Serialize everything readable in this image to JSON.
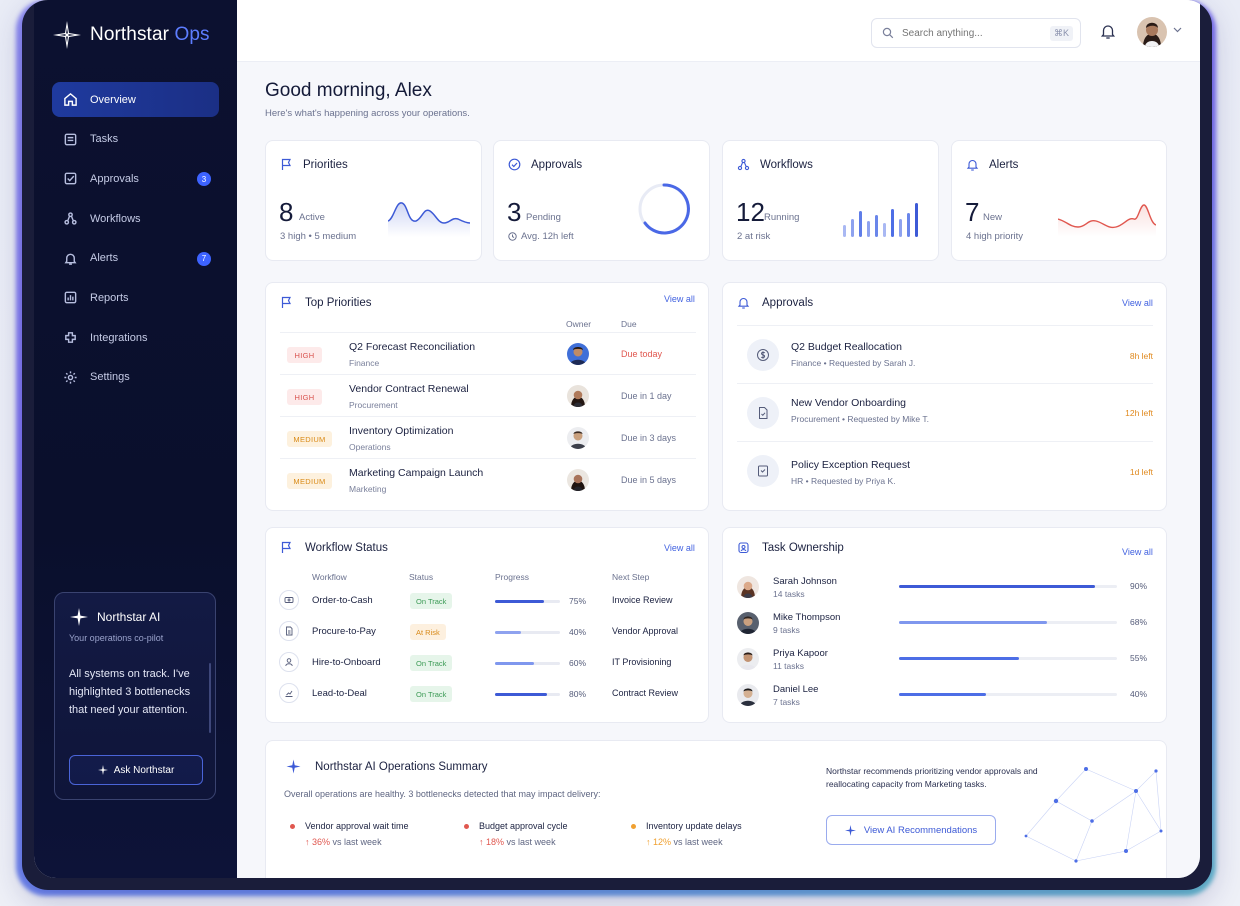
{
  "app": {
    "name_main": "Northstar",
    "name_accent": "Ops"
  },
  "sidebar": {
    "items": [
      {
        "label": "Overview",
        "icon": "home-icon",
        "active": true
      },
      {
        "label": "Tasks",
        "icon": "tasks-icon"
      },
      {
        "label": "Approvals",
        "icon": "approvals-icon",
        "badge": "3"
      },
      {
        "label": "Workflows",
        "icon": "workflow-icon"
      },
      {
        "label": "Alerts",
        "icon": "bell-icon",
        "badge": "7"
      },
      {
        "label": "Reports",
        "icon": "reports-icon"
      },
      {
        "label": "Integrations",
        "icon": "integrations-icon"
      },
      {
        "label": "Settings",
        "icon": "gear-icon"
      }
    ],
    "ai": {
      "title": "Northstar AI",
      "subtitle": "Your operations co-pilot",
      "message": "All systems on track. I've highlighted 3 bottlenecks that need your attention.",
      "button": "Ask Northstar"
    }
  },
  "topbar": {
    "search_placeholder": "Search anything...",
    "shortcut": "⌘K"
  },
  "greeting": {
    "title": "Good morning, Alex",
    "subtitle": "Here's what's happening across your operations."
  },
  "stats": [
    {
      "title": "Priorities",
      "value": "8",
      "unit": "Active",
      "meta": "3 high  •  5 medium"
    },
    {
      "title": "Approvals",
      "value": "3",
      "unit": "Pending",
      "meta": "Avg. 12h left"
    },
    {
      "title": "Workflows",
      "value": "12",
      "unit": "Running",
      "meta": "2 at risk"
    },
    {
      "title": "Alerts",
      "value": "7",
      "unit": "New",
      "meta": "4 high priority"
    }
  ],
  "top_priorities": {
    "title": "Top Priorities",
    "view_all": "View all",
    "col_owner": "Owner",
    "col_due": "Due",
    "rows": [
      {
        "level": "HIGH",
        "name": "Q2 Forecast Reconciliation",
        "dept": "Finance",
        "due": "Due today"
      },
      {
        "level": "HIGH",
        "name": "Vendor Contract Renewal",
        "dept": "Procurement",
        "due": "Due in 1 day"
      },
      {
        "level": "MEDIUM",
        "name": "Inventory Optimization",
        "dept": "Operations",
        "due": "Due in 3 days"
      },
      {
        "level": "MEDIUM",
        "name": "Marketing Campaign Launch",
        "dept": "Marketing",
        "due": "Due in 5 days"
      }
    ]
  },
  "approvals": {
    "title": "Approvals",
    "view_all": "View all",
    "rows": [
      {
        "name": "Q2 Budget Reallocation",
        "dept": "Finance",
        "requested": "Requested by Sarah J.",
        "left": "8h left"
      },
      {
        "name": "New Vendor Onboarding",
        "dept": "Procurement",
        "requested": "Requested by Mike T.",
        "left": "12h left"
      },
      {
        "name": "Policy Exception Request",
        "dept": "HR",
        "requested": "Requested by Priya K.",
        "left": "1d left"
      }
    ]
  },
  "workflow_status": {
    "title": "Workflow Status",
    "view_all": "View all",
    "cols": {
      "workflow": "Workflow",
      "status": "Status",
      "progress": "Progress",
      "next": "Next Step"
    },
    "rows": [
      {
        "name": "Order-to-Cash",
        "status": "On Track",
        "progress": 75,
        "pct": "75%",
        "next": "Invoice Review"
      },
      {
        "name": "Procure-to-Pay",
        "status": "At Risk",
        "progress": 40,
        "pct": "40%",
        "next": "Vendor Approval"
      },
      {
        "name": "Hire-to-Onboard",
        "status": "On Track",
        "progress": 60,
        "pct": "60%",
        "next": "IT Provisioning"
      },
      {
        "name": "Lead-to-Deal",
        "status": "On Track",
        "progress": 80,
        "pct": "80%",
        "next": "Contract Review"
      }
    ]
  },
  "task_ownership": {
    "title": "Task Ownership",
    "view_all": "View all",
    "rows": [
      {
        "name": "Sarah Johnson",
        "tasks": "14 tasks",
        "progress": 90,
        "pct": "90%"
      },
      {
        "name": "Mike Thompson",
        "tasks": "9 tasks",
        "progress": 68,
        "pct": "68%"
      },
      {
        "name": "Priya Kapoor",
        "tasks": "11 tasks",
        "progress": 55,
        "pct": "55%"
      },
      {
        "name": "Daniel Lee",
        "tasks": "7 tasks",
        "progress": 40,
        "pct": "40%"
      }
    ]
  },
  "summary": {
    "title": "Northstar AI Operations Summary",
    "subtitle": "Overall operations are healthy. 3 bottlenecks detected that may impact delivery:",
    "metrics": [
      {
        "name": "Vendor approval wait time",
        "delta": "36%",
        "suffix": "vs last week",
        "color": "#e0574f"
      },
      {
        "name": "Budget approval cycle",
        "delta": "18%",
        "suffix": "vs last week",
        "color": "#e0574f"
      },
      {
        "name": "Inventory update delays",
        "delta": "12%",
        "suffix": "vs last week",
        "color": "#f0a030"
      }
    ],
    "recommendation": "Northstar recommends prioritizing vendor approvals and reallocating capacity from Marketing tasks.",
    "button": "View AI Recommendations"
  },
  "colors": {
    "accent": "#3d63ff",
    "sidebar_bg": "#0c1130",
    "high": "#d9534f",
    "medium": "#d98a16",
    "on_track": "#3b9a55"
  }
}
